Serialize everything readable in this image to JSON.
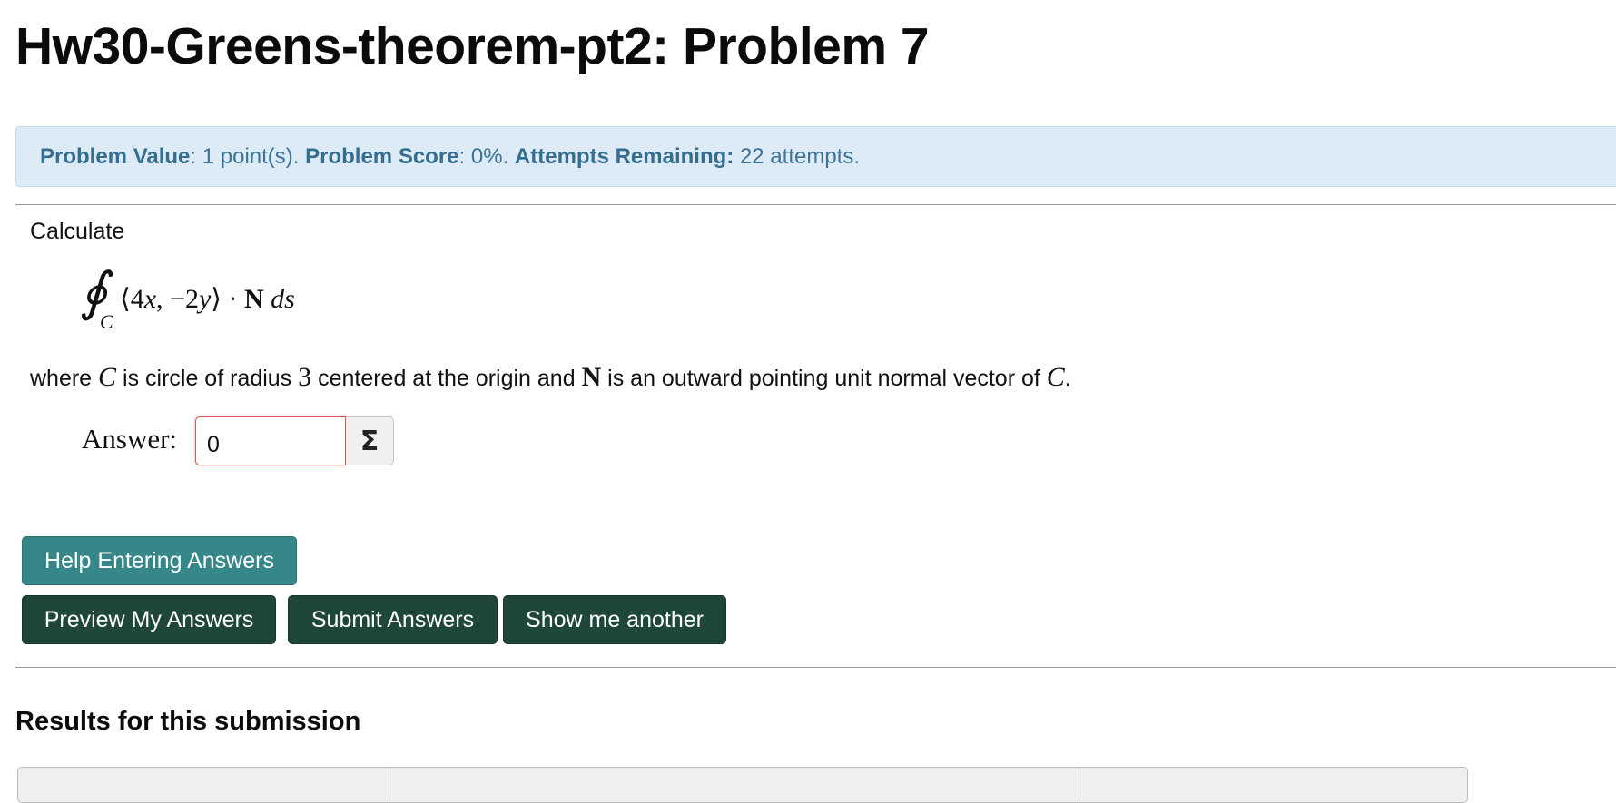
{
  "page": {
    "title": "Hw30-Greens-theorem-pt2: Problem 7"
  },
  "info_bar": {
    "value_label": "Problem Value",
    "value_text": ": 1 point(s).",
    "score_label": "Problem Score",
    "score_text": ": 0%.",
    "attempts_label": "Attempts Remaining:",
    "attempts_text": "22 attempts.",
    "background_color": "#dcebf5",
    "text_color": "#3d7396"
  },
  "problem": {
    "intro": "Calculate",
    "integral": {
      "symbol": "∮",
      "subscript": "C",
      "vector_open": "⟨4",
      "var_x": "x",
      "comma_minus": ", −2",
      "var_y": "y",
      "vector_close": "⟩ · ",
      "normal": "N",
      "ds": "ds"
    },
    "description": {
      "part1": "where ",
      "var_c1": "C",
      "part2": " is circle of radius ",
      "radius": "3",
      "part3": " centered at the origin and ",
      "var_n": "N",
      "part4": " is an outward pointing unit normal vector of ",
      "var_c2": "C",
      "part5": "."
    },
    "answer_label": "Answer:",
    "answer_value": "0",
    "equation_editor_icon": "Σ"
  },
  "buttons": {
    "help": "Help Entering Answers",
    "preview": "Preview My Answers",
    "submit": "Submit Answers",
    "another": "Show me another",
    "help_color": "#35878a",
    "dark_color": "#1f463a"
  },
  "results": {
    "heading": "Results for this submission"
  }
}
